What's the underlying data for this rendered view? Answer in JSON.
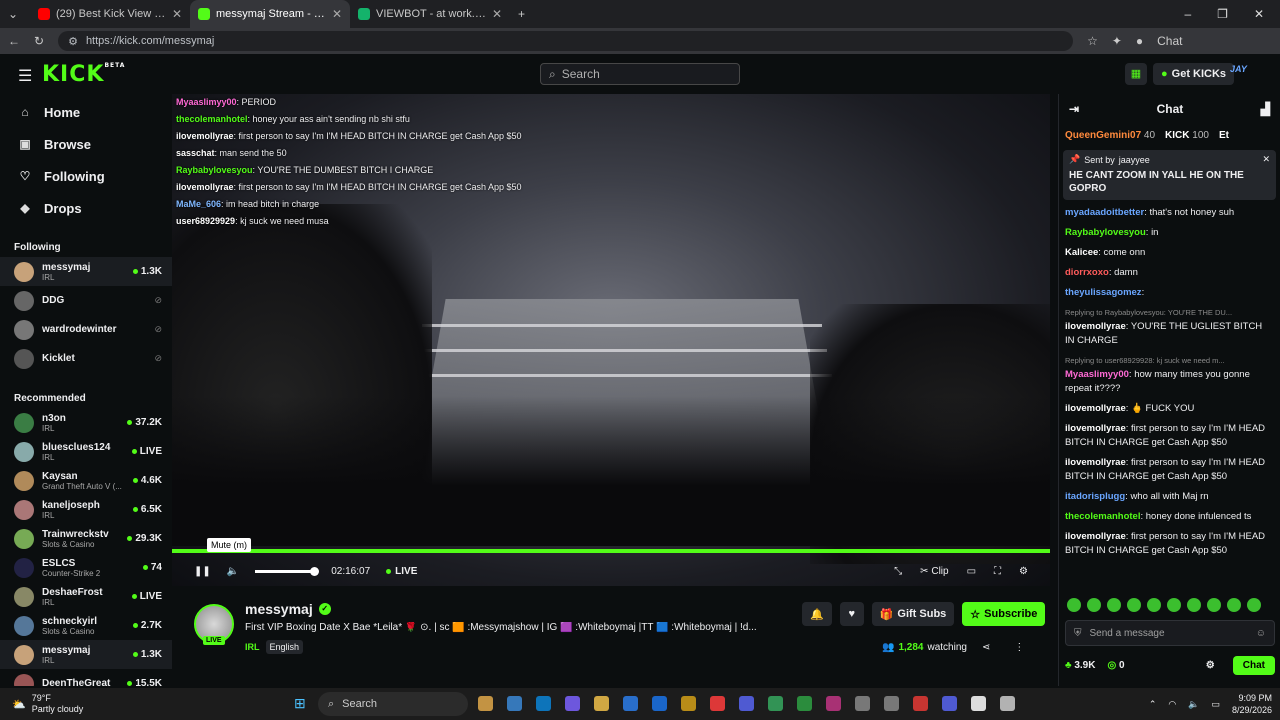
{
  "browser": {
    "tabs": [
      {
        "title": "(29) Best Kick View Bot | Views & F",
        "fav": "#ff0000",
        "active": false
      },
      {
        "title": "messymaj Stream - Watch Live",
        "fav": "#53fc18",
        "active": true
      },
      {
        "title": "VIEWBOT - at work.ink",
        "fav": "#14b36b",
        "active": false
      }
    ],
    "url": "https://kick.com/messymaj",
    "chrome_chat": "Chat"
  },
  "topnav": {
    "logo": "KICK",
    "logo_beta": "BETA",
    "search_placeholder": "Search",
    "get_kicks": "Get KICKs"
  },
  "sidebar": {
    "nav": [
      {
        "label": "Home",
        "icon": "home-icon",
        "glyph": "⌂"
      },
      {
        "label": "Browse",
        "icon": "browse-icon",
        "glyph": "▣"
      },
      {
        "label": "Following",
        "icon": "heart-icon",
        "glyph": "♡"
      },
      {
        "label": "Drops",
        "icon": "drops-icon",
        "glyph": "◆"
      }
    ],
    "following_title": "Following",
    "following": [
      {
        "name": "messymaj",
        "cat": "IRL",
        "viewers": "1.3K",
        "live": true,
        "color": "#c7a27a"
      },
      {
        "name": "DDG",
        "cat": "",
        "viewers": "",
        "live": false,
        "color": "#666"
      },
      {
        "name": "wardrodewinter",
        "cat": "",
        "viewers": "",
        "live": false,
        "color": "#777"
      },
      {
        "name": "Kicklet",
        "cat": "",
        "viewers": "",
        "live": false,
        "color": "#555"
      }
    ],
    "recommended_title": "Recommended",
    "recommended": [
      {
        "name": "n3on",
        "cat": "IRL",
        "viewers": "37.2K",
        "color": "#3a7d44"
      },
      {
        "name": "bluesclues124",
        "cat": "IRL",
        "viewers": "LIVE",
        "color": "#8aa"
      },
      {
        "name": "Kaysan",
        "cat": "Grand Theft Auto V (...",
        "viewers": "4.6K",
        "color": "#b08a5a"
      },
      {
        "name": "kaneljoseph",
        "cat": "IRL",
        "viewers": "6.5K",
        "color": "#a77"
      },
      {
        "name": "Trainwreckstv",
        "cat": "Slots & Casino",
        "viewers": "29.3K",
        "color": "#7a5"
      },
      {
        "name": "ESLCS",
        "cat": "Counter-Strike 2",
        "viewers": "74",
        "color": "#224"
      },
      {
        "name": "DeshaeFrost",
        "cat": "IRL",
        "viewers": "LIVE",
        "color": "#886"
      },
      {
        "name": "schneckyirl",
        "cat": "Slots & Casino",
        "viewers": "2.7K",
        "color": "#579"
      },
      {
        "name": "messymaj",
        "cat": "IRL",
        "viewers": "1.3K",
        "color": "#c7a27a"
      },
      {
        "name": "DeenTheGreat",
        "cat": "",
        "viewers": "15.5K",
        "color": "#955"
      }
    ]
  },
  "player": {
    "overlay_chat": [
      {
        "user": "Myaaslimyy00",
        "text": ": PERIOD",
        "color": "#ff6ad5"
      },
      {
        "user": "thecolemanhotel",
        "text": ": honey your ass ain't sending nb shi stfu",
        "color": "#53fc18"
      },
      {
        "user": "ilovemollyrae",
        "text": ": first person to say I'm I'M HEAD BITCH IN CHARGE get Cash App $50",
        "color": "#ffffff"
      },
      {
        "user": "sasschat",
        "text": ": man send the 50",
        "color": "#ffffff"
      },
      {
        "user": "Raybabylovesyou",
        "text": ": YOU'RE THE DUMBEST BITCH I CHARGE",
        "color": "#53fc18"
      },
      {
        "user": "ilovemollyrae",
        "text": ": first person to say I'm I'M HEAD BITCH IN CHARGE get Cash App $50",
        "color": "#ffffff"
      },
      {
        "user": "MaMe_606",
        "text": ": im head bitch in charge",
        "color": "#7fb7ff"
      },
      {
        "user": "user68929929",
        "text": ": kj suck we need musa",
        "color": "#ffffff"
      }
    ],
    "time": "02:16:07",
    "live_label": "LIVE",
    "tooltip": "Mute (m)",
    "clip_label": "Clip",
    "progress_fraction": 1.0
  },
  "stream": {
    "name": "messymaj",
    "title": "First VIP Boxing Date X Bae *Leila* 🌹 ⊙. | sc 🟧 :Messymajshow | IG 🟪 :Whiteboymaj |TT 🟦 :Whiteboymaj | !d...",
    "category": "IRL",
    "language": "English",
    "live_badge": "LIVE",
    "gift_subs": "Gift Subs",
    "subscribe": "Subscribe",
    "watching_count": "1,284",
    "watching_label": "watching"
  },
  "chat": {
    "title": "Chat",
    "leaderboard": [
      {
        "name": "QueenGemini07",
        "value": "40",
        "color": "#ff8a3d"
      },
      {
        "name": "KICK",
        "value": "100",
        "color": "#ffffff"
      },
      {
        "name": "Et",
        "value": "",
        "color": "#ffffff"
      }
    ],
    "pinned": {
      "sent_by_label": "Sent by",
      "user": "jaayyee",
      "text": "HE CANT ZOOM IN YALL HE ON THE GOPRO"
    },
    "messages": [
      {
        "user": "myadaadoitbetter",
        "text": ": that's not honey suh",
        "color": "#6aa6ff",
        "reply": ""
      },
      {
        "user": "Raybabylovesyou",
        "text": ": in",
        "color": "#53fc18",
        "reply": ""
      },
      {
        "user": "Kalicee",
        "text": ": come onn",
        "color": "#ffffff",
        "reply": ""
      },
      {
        "user": "diorrxoxo",
        "text": ": damn",
        "color": "#ff5c5c",
        "reply": ""
      },
      {
        "user": "theyulissagomez",
        "text": ":",
        "color": "#6aa6ff",
        "reply": ""
      },
      {
        "user": "ilovemollyrae",
        "text": ": YOU'RE THE UGLIEST BITCH IN CHARGE",
        "color": "#ffffff",
        "reply": "Replying to Raybabylovesyou: YOU'RE THE DU..."
      },
      {
        "user": "Myaaslimyy00",
        "text": ": how many times you gonne repeat it????",
        "color": "#ff6ad5",
        "reply": "Replying to user68929928: kj suck we need m..."
      },
      {
        "user": "ilovemollyrae",
        "text": ": 🖕 FUCK YOU",
        "color": "#ffffff",
        "reply": ""
      },
      {
        "user": "ilovemollyrae",
        "text": ": first person to say I'm I'M HEAD BITCH IN CHARGE get Cash App $50",
        "color": "#ffffff",
        "reply": ""
      },
      {
        "user": "ilovemollyrae",
        "text": ": first person to say I'm I'M HEAD BITCH IN CHARGE get Cash App $50",
        "color": "#ffffff",
        "reply": ""
      },
      {
        "user": "itadorisplugg",
        "text": ": who all with Maj rn",
        "color": "#6aa6ff",
        "reply": ""
      },
      {
        "user": "thecolemanhotel",
        "text": ": honey done infulenced ts",
        "color": "#53fc18",
        "reply": ""
      },
      {
        "user": "ilovemollyrae",
        "text": ": first person to say I'm I'M HEAD BITCH IN CHARGE get Cash App $50",
        "color": "#ffffff",
        "reply": ""
      }
    ],
    "input_placeholder": "Send a message",
    "points": "3.9K",
    "kicks": "0",
    "chat_button": "Chat"
  },
  "taskbar": {
    "temp": "79°F",
    "weather": "Partly cloudy",
    "search": "Search",
    "time": "9:09 PM",
    "date": "8/29/2026"
  }
}
